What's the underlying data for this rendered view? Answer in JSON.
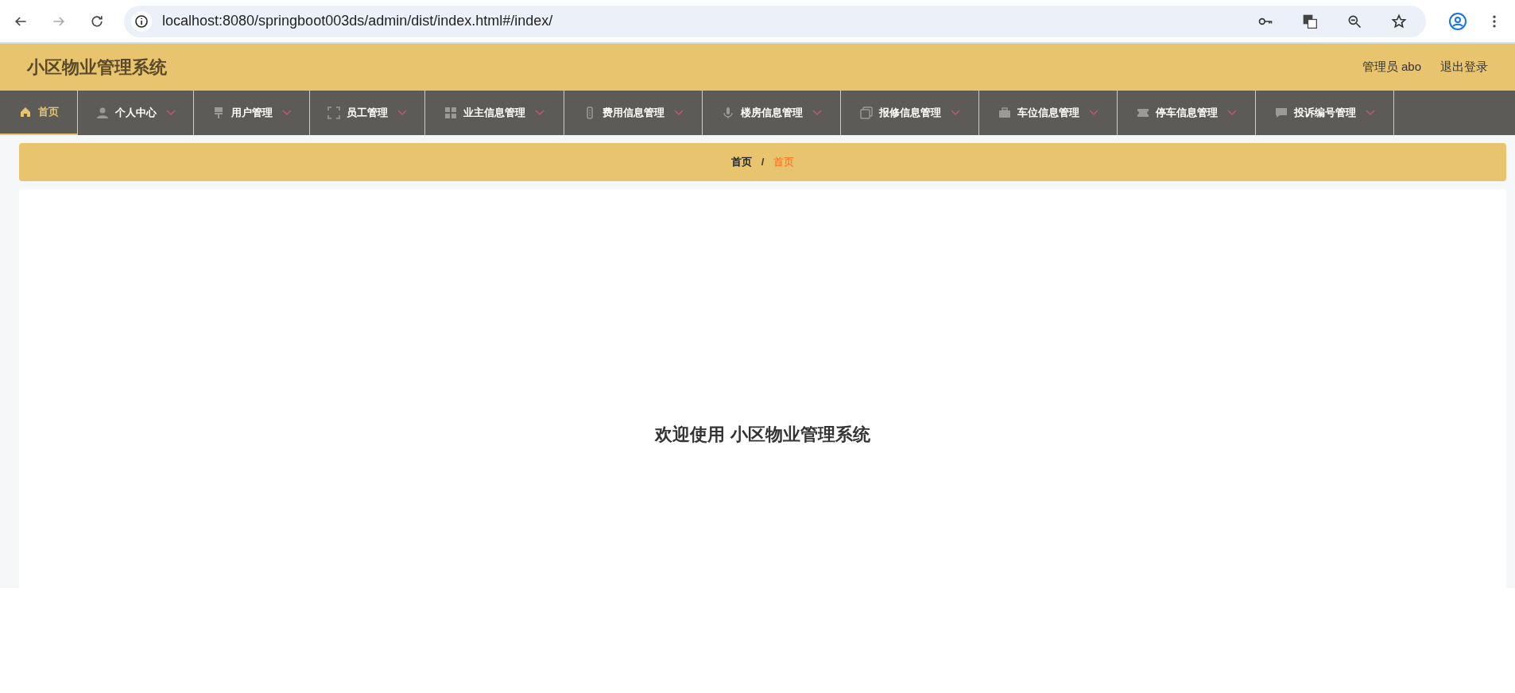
{
  "browser": {
    "url": "localhost:8080/springboot003ds/admin/dist/index.html#/index/"
  },
  "header": {
    "title": "小区物业管理系统",
    "user": "管理员 abo",
    "logout": "退出登录"
  },
  "nav": [
    {
      "label": "首页",
      "kind": "link",
      "selected": true
    },
    {
      "label": "个人中心",
      "kind": "dropdown",
      "selected": false
    },
    {
      "label": "用户管理",
      "kind": "dropdown",
      "selected": false
    },
    {
      "label": "员工管理",
      "kind": "dropdown",
      "selected": false
    },
    {
      "label": "业主信息管理",
      "kind": "dropdown",
      "selected": false
    },
    {
      "label": "费用信息管理",
      "kind": "dropdown",
      "selected": false
    },
    {
      "label": "楼房信息管理",
      "kind": "dropdown",
      "selected": false
    },
    {
      "label": "报修信息管理",
      "kind": "dropdown",
      "selected": false
    },
    {
      "label": "车位信息管理",
      "kind": "dropdown",
      "selected": false
    },
    {
      "label": "停车信息管理",
      "kind": "dropdown",
      "selected": false
    },
    {
      "label": "投诉编号管理",
      "kind": "dropdown",
      "selected": false
    }
  ],
  "breadcrumb_separator": "/",
  "breadcrumb": [
    {
      "label": "首页",
      "selected": false
    },
    {
      "label": "首页",
      "selected": true
    }
  ],
  "welcome": "欢迎使用 小区物业管理系统"
}
